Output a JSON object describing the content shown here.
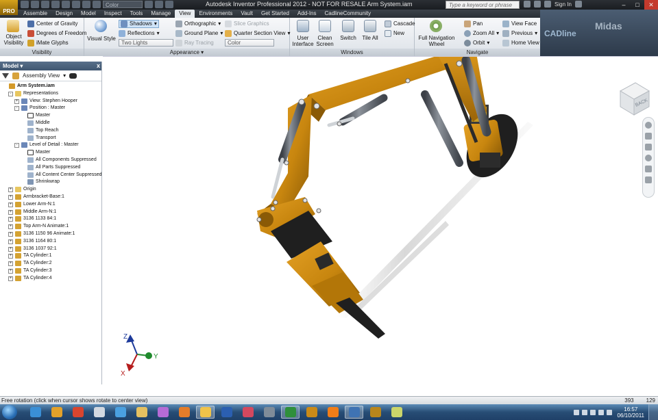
{
  "window": {
    "title": "Autodesk Inventor Professional 2012 - NOT FOR RESALE    Arm System.iam",
    "logo_text": "PRO",
    "qat_color_select": "Color",
    "search_placeholder": "Type a keyword or phrase",
    "sign_in": "Sign In",
    "controls": {
      "minimize": "–",
      "maximize": "□",
      "close": "✕"
    }
  },
  "tabs": [
    "Assemble",
    "Design",
    "Model",
    "Inspect",
    "Tools",
    "Manage",
    "View",
    "Environments",
    "Vault",
    "Get Started",
    "Add-Ins",
    "CadlineCommunity"
  ],
  "active_tab": "View",
  "ribbon": {
    "visibility": {
      "label": "Visibility",
      "object_visibility": "Object Visibility",
      "center_of_gravity": "Center of Gravity",
      "degrees_of_freedom": "Degrees of Freedom",
      "imate_glyphs": "iMate Glyphs"
    },
    "appearance": {
      "label": "Appearance ▾",
      "visual_style": "Visual Style",
      "shadows": "Shadows",
      "reflections": "Reflections",
      "lighting_select": "Two Lights",
      "orthographic": "Orthographic",
      "ground_plane": "Ground Plane",
      "ray_tracing": "Ray Tracing",
      "slice_graphics": "Slice Graphics",
      "quarter_section_view": "Quarter Section View",
      "color_select": "Color"
    },
    "windows": {
      "label": "Windows",
      "user_interface": "User Interface",
      "clean_screen": "Clean Screen",
      "switch": "Switch",
      "tile_all": "Tile All",
      "cascade": "Cascade",
      "new": "New"
    },
    "navigate": {
      "label": "Navigate",
      "full_navigation_wheel": "Full Navigation Wheel",
      "pan": "Pan",
      "zoom_all": "Zoom All",
      "orbit": "Orbit",
      "view_face": "View Face",
      "previous": "Previous",
      "home_view": "Home View"
    },
    "brand_cadline": "CADline",
    "brand_midas": "Midas"
  },
  "browser": {
    "title": "Model ▾",
    "close": "x",
    "view_select": "Assembly View",
    "tree": [
      {
        "label": "Arm System.iam",
        "level": 0,
        "bold": true,
        "icon": "assembly-icon"
      },
      {
        "label": "Representations",
        "level": 1,
        "expander": "-",
        "icon": "folder-icon"
      },
      {
        "label": "View: Stephen Hooper",
        "level": 2,
        "expander": "+",
        "icon": "view-rep-icon"
      },
      {
        "label": "Position : Master",
        "level": 2,
        "expander": "-",
        "icon": "position-rep-icon"
      },
      {
        "label": "Master",
        "level": 3,
        "icon": "check-icon"
      },
      {
        "label": "Middle",
        "level": 3,
        "icon": "rep-item-icon"
      },
      {
        "label": "Top Reach",
        "level": 3,
        "icon": "rep-item-icon"
      },
      {
        "label": "Transport",
        "level": 3,
        "icon": "rep-item-icon"
      },
      {
        "label": "Level of Detail : Master",
        "level": 2,
        "expander": "-",
        "icon": "lod-icon"
      },
      {
        "label": "Master",
        "level": 3,
        "icon": "check-icon"
      },
      {
        "label": "All Components Suppressed",
        "level": 3,
        "icon": "lod-item-icon"
      },
      {
        "label": "All Parts Suppressed",
        "level": 3,
        "icon": "lod-item-icon"
      },
      {
        "label": "All Content Center Suppressed",
        "level": 3,
        "icon": "lod-item-icon"
      },
      {
        "label": "Shrinkwrap",
        "level": 3,
        "icon": "shrinkwrap-icon"
      },
      {
        "label": "Origin",
        "level": 1,
        "expander": "+",
        "icon": "folder-icon"
      },
      {
        "label": "Armbracket-Base:1",
        "level": 1,
        "expander": "+",
        "icon": "part-icon"
      },
      {
        "label": "Lower Arm-N:1",
        "level": 1,
        "expander": "+",
        "icon": "part-icon"
      },
      {
        "label": "Middle Arm-N:1",
        "level": 1,
        "expander": "+",
        "icon": "part-icon"
      },
      {
        "label": "3136 1133 84:1",
        "level": 1,
        "expander": "+",
        "icon": "part-icon"
      },
      {
        "label": "Top Arm-N Animate:1",
        "level": 1,
        "expander": "+",
        "icon": "part-icon"
      },
      {
        "label": "3136 1150 96 Animate:1",
        "level": 1,
        "expander": "+",
        "icon": "part-icon"
      },
      {
        "label": "3136 1164 80:1",
        "level": 1,
        "expander": "+",
        "icon": "part-icon"
      },
      {
        "label": "3136 1037 92:1",
        "level": 1,
        "expander": "+",
        "icon": "part-icon"
      },
      {
        "label": "TA Cylinder:1",
        "level": 1,
        "expander": "+",
        "icon": "subassembly-icon"
      },
      {
        "label": "TA Cylinder:2",
        "level": 1,
        "expander": "+",
        "icon": "subassembly-icon"
      },
      {
        "label": "TA Cylinder:3",
        "level": 1,
        "expander": "+",
        "icon": "subassembly-icon"
      },
      {
        "label": "TA Cylinder:4",
        "level": 1,
        "expander": "+",
        "icon": "subassembly-icon"
      }
    ]
  },
  "viewport": {
    "viewcube_label": "BACK",
    "triad": {
      "x": "X",
      "y": "Y",
      "z": "Z"
    },
    "colors": {
      "arm": "#c8860f",
      "arm_dark": "#8a5a06",
      "cylinder": "#6b7079",
      "black": "#1c1c1c"
    }
  },
  "status": {
    "message": "Free rotation (click when cursor shows rotate to center view)",
    "num1": "393",
    "num2": "129"
  },
  "taskbar": {
    "apps": [
      "start-menu",
      "ie-icon",
      "chrome-icon",
      "tools-icon",
      "display-icon",
      "folder-icon",
      "paint-icon",
      "media-icon",
      "explorer-icon",
      "word-icon",
      "snip-icon",
      "calc-icon",
      "excel-icon",
      "inventor-icon",
      "vlc-icon",
      "network-icon",
      "inventor-pro-icon",
      "notes-icon",
      "camera-icon"
    ],
    "time": "16:57",
    "date": "06/10/2011"
  }
}
